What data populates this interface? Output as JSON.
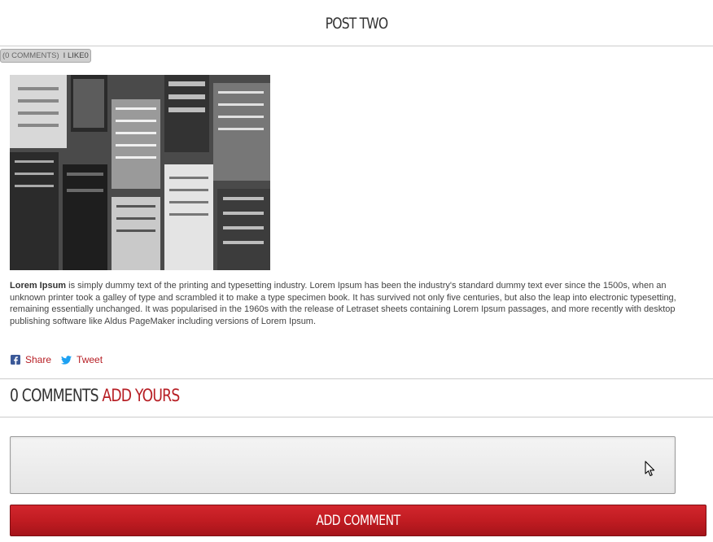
{
  "post": {
    "title": "POST TWO",
    "comments_meta": "(0 COMMENTS)",
    "like_label": "I LIKE",
    "like_count": "0",
    "image_alt": "Black and white aerial view of city buildings",
    "body_lead": "Lorem Ipsum",
    "body_text": " is simply dummy text of the printing and typesetting industry. Lorem Ipsum has been the industry's standard dummy text ever since the 1500s, when an unknown printer took a galley of type and scrambled it to make a type specimen book. It has survived not only five centuries, but also the leap into electronic typesetting, remaining essentially unchanged. It was popularised in the 1960s with the release of Letraset sheets containing Lorem Ipsum passages, and more recently with desktop publishing software like Aldus PageMaker including versions of Lorem Ipsum."
  },
  "share": {
    "facebook_label": "Share",
    "twitter_label": "Tweet",
    "facebook_icon": "facebook-icon",
    "twitter_icon": "twitter-icon"
  },
  "comments": {
    "count_label": "0 COMMENTS",
    "add_yours_label": "ADD YOURS",
    "textarea_value": "",
    "submit_label": "ADD COMMENT"
  },
  "colors": {
    "accent": "#b71f25",
    "text": "#333333",
    "meta_bar": "#cfcfcf"
  }
}
